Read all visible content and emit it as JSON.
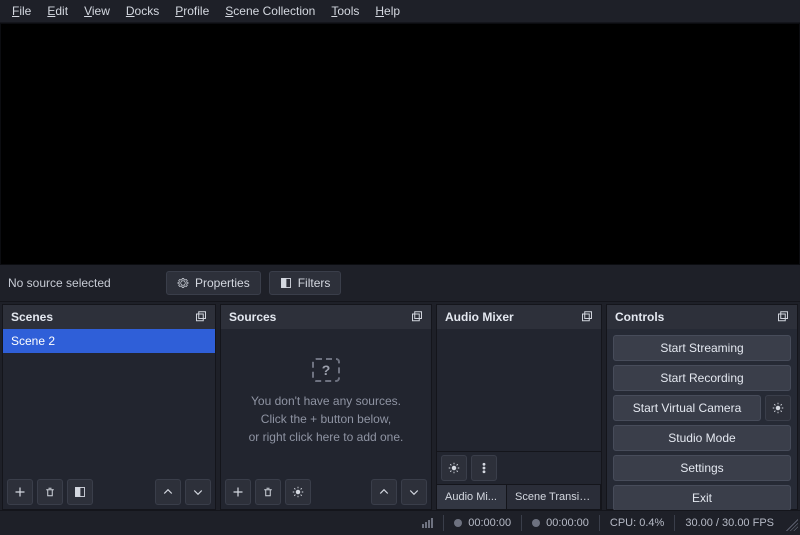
{
  "menu": [
    "File",
    "Edit",
    "View",
    "Docks",
    "Profile",
    "Scene Collection",
    "Tools",
    "Help"
  ],
  "sourceToolbar": {
    "status": "No source selected",
    "properties": "Properties",
    "filters": "Filters"
  },
  "docks": {
    "scenes": {
      "title": "Scenes",
      "items": [
        "Scene 2"
      ]
    },
    "sources": {
      "title": "Sources",
      "empty1": "You don't have any sources.",
      "empty2": "Click the + button below,",
      "empty3": "or right click here to add one."
    },
    "audio": {
      "title": "Audio Mixer",
      "tabs": [
        "Audio Mi...",
        "Scene Transiti..."
      ]
    },
    "controls": {
      "title": "Controls",
      "buttons": {
        "stream": "Start Streaming",
        "record": "Start Recording",
        "vcam": "Start Virtual Camera",
        "studio": "Studio Mode",
        "settings": "Settings",
        "exit": "Exit"
      }
    }
  },
  "status": {
    "liveTime": "00:00:00",
    "recTime": "00:00:00",
    "cpu": "CPU: 0.4%",
    "fps": "30.00 / 30.00 FPS"
  }
}
